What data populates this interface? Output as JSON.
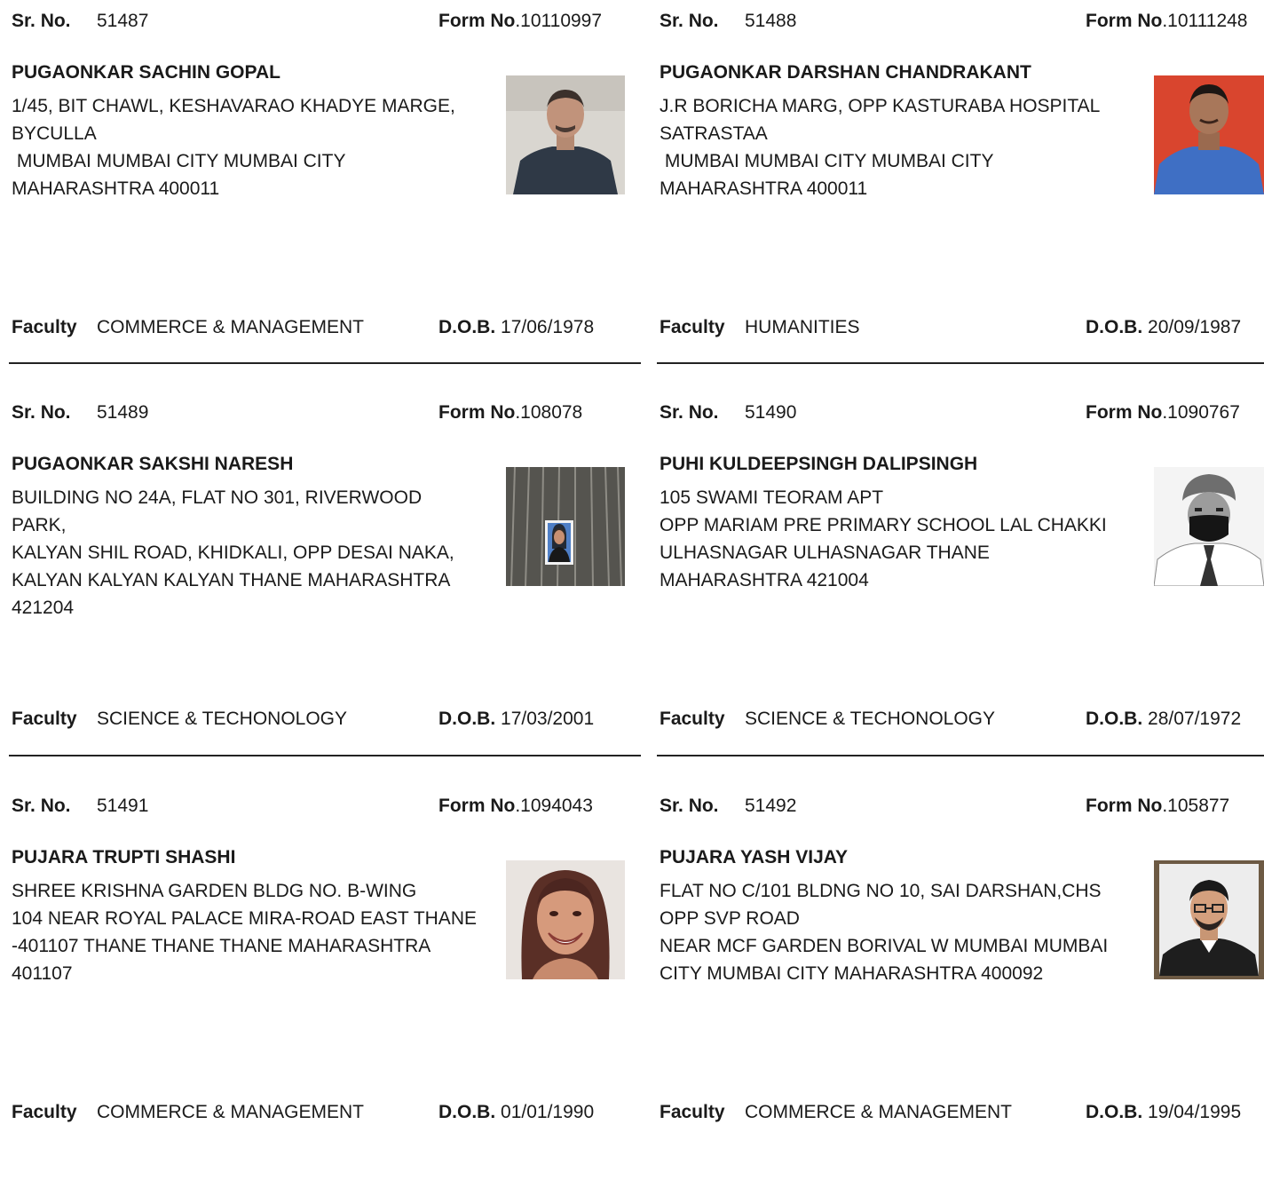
{
  "labels": {
    "sr_no": "Sr. No.",
    "form_no": "Form No",
    "faculty": "Faculty",
    "dob": "D.O.B."
  },
  "records": [
    {
      "sr_no": "51487",
      "form_no": ".10110997",
      "name": "PUGAONKAR SACHIN GOPAL",
      "address": [
        "1/45, BIT CHAWL, KESHAVARAO KHADYE MARGE,",
        "BYCULLA",
        " MUMBAI MUMBAI CITY MUMBAI CITY",
        "MAHARASHTRA 400011"
      ],
      "faculty": "COMMERCE & MANAGEMENT",
      "dob": "17/06/1978"
    },
    {
      "sr_no": "51488",
      "form_no": ".10111248",
      "name": "PUGAONKAR DARSHAN CHANDRAKANT",
      "address": [
        "J.R BORICHA MARG, OPP KASTURABA HOSPITAL",
        "SATRASTAA",
        " MUMBAI MUMBAI CITY MUMBAI CITY",
        "MAHARASHTRA 400011"
      ],
      "faculty": "HUMANITIES",
      "dob": "20/09/1987"
    },
    {
      "sr_no": "51489",
      "form_no": ".108078",
      "name": "PUGAONKAR SAKSHI NARESH",
      "address": [
        "BUILDING NO 24A, FLAT NO 301, RIVERWOOD",
        "PARK,",
        "KALYAN SHIL ROAD, KHIDKALI, OPP DESAI NAKA,",
        "KALYAN KALYAN KALYAN THANE MAHARASHTRA",
        "421204"
      ],
      "faculty": "SCIENCE & TECHONOLOGY",
      "dob": "17/03/2001"
    },
    {
      "sr_no": "51490",
      "form_no": ".1090767",
      "name": "PUHI KULDEEPSINGH DALIPSINGH",
      "address": [
        "105 SWAMI TEORAM APT",
        "OPP MARIAM PRE PRIMARY SCHOOL LAL CHAKKI",
        "ULHASNAGAR ULHASNAGAR THANE",
        "MAHARASHTRA 421004"
      ],
      "faculty": "SCIENCE & TECHONOLOGY",
      "dob": "28/07/1972"
    },
    {
      "sr_no": "51491",
      "form_no": ".1094043",
      "name": "PUJARA TRUPTI SHASHI",
      "address": [
        "SHREE KRISHNA GARDEN BLDG NO. B-WING",
        "104 NEAR ROYAL PALACE MIRA-ROAD EAST THANE",
        "-401107 THANE THANE THANE MAHARASHTRA",
        "401107"
      ],
      "faculty": "COMMERCE & MANAGEMENT",
      "dob": "01/01/1990"
    },
    {
      "sr_no": "51492",
      "form_no": ".105877",
      "name": "PUJARA YASH VIJAY",
      "address": [
        "FLAT NO C/101 BLDNG NO 10, SAI DARSHAN,CHS",
        "OPP SVP ROAD",
        "NEAR MCF GARDEN BORIVAL W MUMBAI MUMBAI",
        "CITY MUMBAI CITY MAHARASHTRA 400092"
      ],
      "faculty": "COMMERCE & MANAGEMENT",
      "dob": "19/04/1995"
    }
  ]
}
